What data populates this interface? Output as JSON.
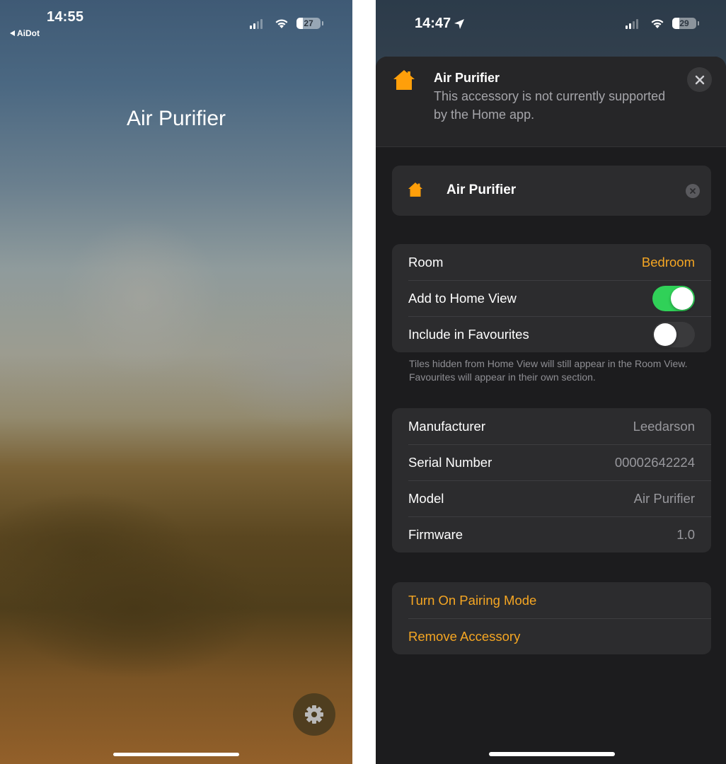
{
  "left_screen": {
    "status_bar": {
      "time": "14:55",
      "back_app_label": "AiDot",
      "signal_bars_active": 2,
      "signal_bars_total": 4,
      "battery_level": "27",
      "battery_fraction": 0.27
    },
    "title": "Air Purifier",
    "settings_button_icon": "gear-icon"
  },
  "right_screen": {
    "status_bar": {
      "time": "14:47",
      "location_icon": "location-arrow-icon",
      "signal_bars_active": 2,
      "signal_bars_total": 4,
      "battery_level": "29",
      "battery_fraction": 0.29
    },
    "header": {
      "icon": "house-icon",
      "title": "Air Purifier",
      "subtitle": "This accessory is not currently supported by the Home app.",
      "close_icon": "close-icon"
    },
    "name_field": {
      "icon": "house-icon",
      "value": "Air Purifier",
      "clear_icon": "clear-icon"
    },
    "settings": {
      "room_label": "Room",
      "room_value": "Bedroom",
      "home_view_label": "Add to Home View",
      "home_view_on": true,
      "favourites_label": "Include in Favourites",
      "favourites_on": false,
      "footnote": "Tiles hidden from Home View will still appear in the Room View. Favourites will appear in their own section."
    },
    "info": [
      {
        "label": "Manufacturer",
        "value": "Leedarson"
      },
      {
        "label": "Serial Number",
        "value": "00002642224"
      },
      {
        "label": "Model",
        "value": "Air Purifier"
      },
      {
        "label": "Firmware",
        "value": "1.0"
      }
    ],
    "actions": {
      "pairing": "Turn On Pairing Mode",
      "remove": "Remove Accessory"
    }
  },
  "colors": {
    "accent": "#f5a623",
    "toggle_on": "#30d158",
    "sheet_bg": "#1c1c1e",
    "card_bg": "#2c2c2e",
    "secondary_text": "#98989d"
  }
}
